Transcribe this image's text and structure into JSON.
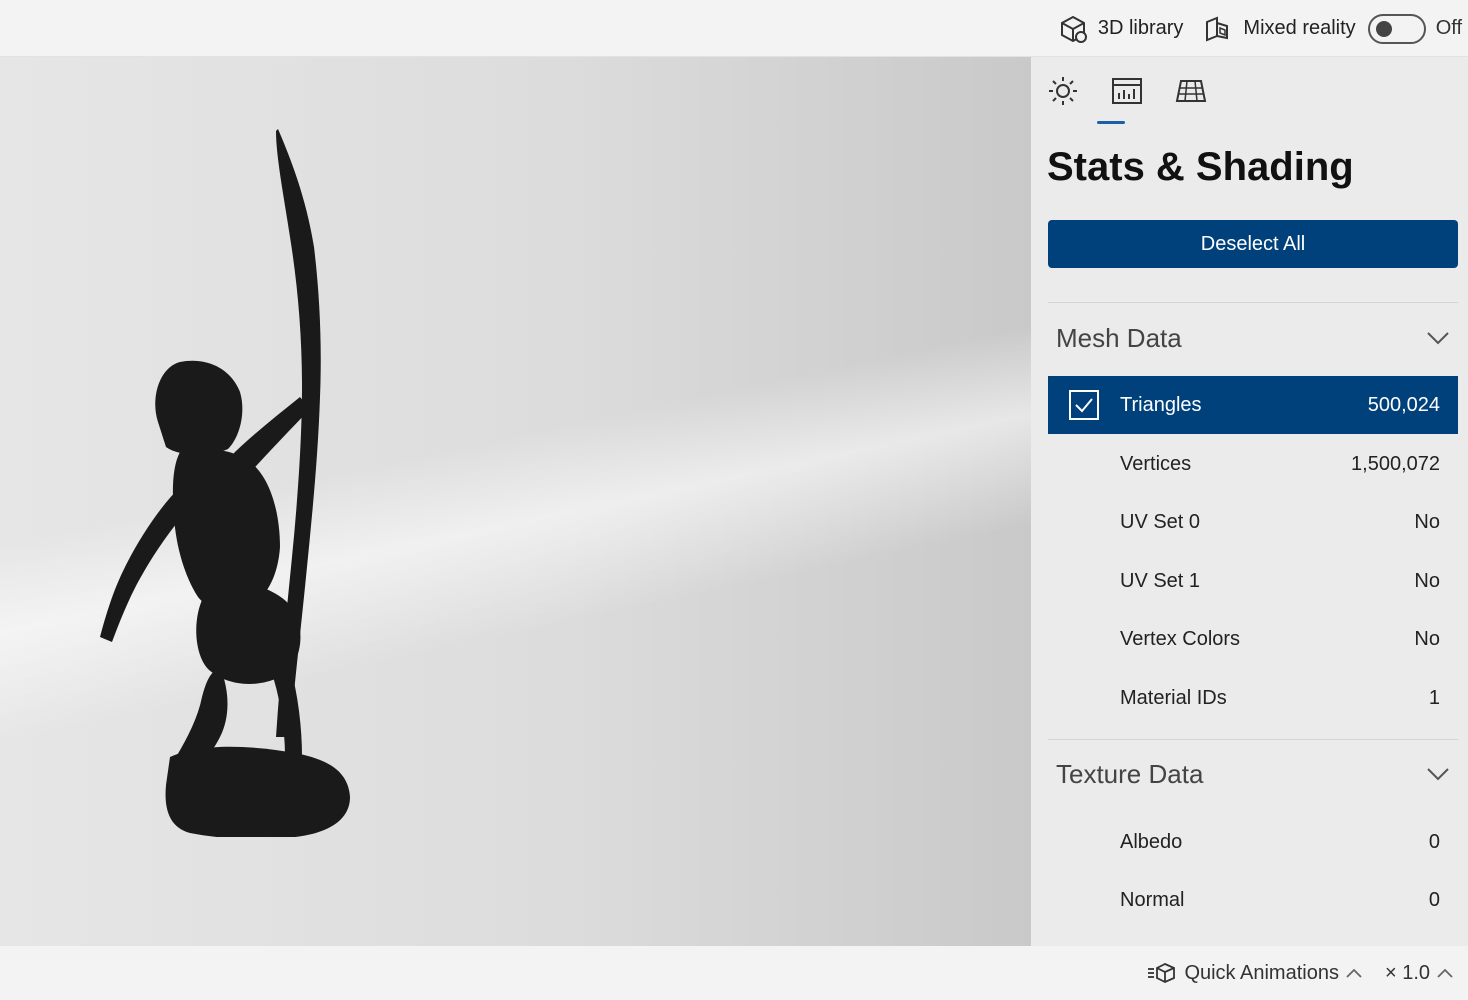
{
  "topbar": {
    "library_label": "3D library",
    "mixed_reality_label": "Mixed reality",
    "toggle_state": "Off"
  },
  "panel": {
    "tabs": [
      {
        "name": "lighting",
        "icon": "sun-icon"
      },
      {
        "name": "stats",
        "icon": "stats-grid-icon",
        "active": true
      },
      {
        "name": "grid",
        "icon": "floor-grid-icon"
      }
    ],
    "title": "Stats & Shading",
    "deselect_label": "Deselect All",
    "mesh": {
      "title": "Mesh Data",
      "rows": [
        {
          "label": "Triangles",
          "value": "500,024",
          "checked": true
        },
        {
          "label": "Vertices",
          "value": "1,500,072"
        },
        {
          "label": "UV Set 0",
          "value": "No"
        },
        {
          "label": "UV Set 1",
          "value": "No"
        },
        {
          "label": "Vertex Colors",
          "value": "No"
        },
        {
          "label": "Material IDs",
          "value": "1"
        }
      ]
    },
    "texture": {
      "title": "Texture Data",
      "rows": [
        {
          "label": "Albedo",
          "value": "0"
        },
        {
          "label": "Normal",
          "value": "0"
        }
      ]
    }
  },
  "bottombar": {
    "quick_animations_label": "Quick Animations",
    "speed_label": "× 1.0"
  },
  "colors": {
    "accent": "#00417c",
    "tab_indicator": "#1c5fa8"
  }
}
